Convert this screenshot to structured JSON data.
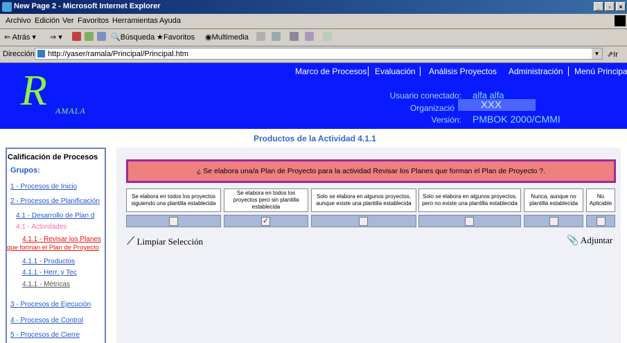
{
  "window": {
    "title": "New Page 2 - Microsoft Internet Explorer"
  },
  "menubar": [
    "Archivo",
    "Edición",
    "Ver",
    "Favoritos",
    "Herramientas",
    "Ayuda"
  ],
  "toolbar": {
    "back": "Atrás",
    "search": "Búsqueda",
    "favorites": "Favoritos",
    "multimedia": "Multimedia"
  },
  "address": {
    "label": "Dirección",
    "url": "http://yaser/ramala/Principal/Principal.htm",
    "go": "Ir"
  },
  "nav": [
    "Marco de Procesos",
    "Evaluación",
    "Análisis Proyectos",
    "Administración",
    "Menú Principal"
  ],
  "logo": {
    "initial": "R",
    "rest": "AMALA"
  },
  "info": {
    "user_label": "Usuario conectado:",
    "user_value": "alfa alfa",
    "org_label": "Organizació",
    "org_value": "XXX",
    "version_label": "Versión:",
    "version_value": "PMBOK 2000/CMMI"
  },
  "page_title": "Productos de la Actividad 4.1.1",
  "sidebar": {
    "heading": "Calificación de Procesos",
    "groups_label": "Grupos:",
    "items": [
      "1 - Procesos de Inicio",
      "2 - Procesos de Planificación",
      "4.1 - Desarrollo de Plan d",
      "4.1 - Actividades",
      "4.1.1 - Revisar los Planes",
      "que forman el Plan de Proyecto",
      "4.1.1 - Productos",
      "4.1.1 - Herr. y Tec",
      "4.1.1 - Métricas",
      "3 - Procesos de Ejecución",
      "4 - Procesos de Control",
      "5 - Procesos de Cierre"
    ]
  },
  "question": "¿ Se elabora una/a Plan de Proyecto para la actividad Revisar los Planes que forman el Plan de Proyecto ?.",
  "options": [
    {
      "label": "Se elabora en todos los proyectos siguiendo una plantilla establecida",
      "checked": false
    },
    {
      "label": "Se elabora en todos los proyectos pero sin plantilla establecida",
      "checked": true
    },
    {
      "label": "Solo se elabora en algunos proyectos, aunque existe una plantilla establecida",
      "checked": false
    },
    {
      "label": "Solo se elabora en algunos proyectos, pero no existe una plantilla establecida",
      "checked": false
    },
    {
      "label": "Nunca, aunque no plantilla establecida",
      "checked": false
    },
    {
      "label": "No Aplicable",
      "checked": false
    }
  ],
  "actions": {
    "clear": "Limpiar Selección",
    "attach": "Adjuntar"
  },
  "colors": {
    "header_bg": "#0a1aff",
    "question_bg": "#f08080",
    "logo": "#8ef04a"
  }
}
